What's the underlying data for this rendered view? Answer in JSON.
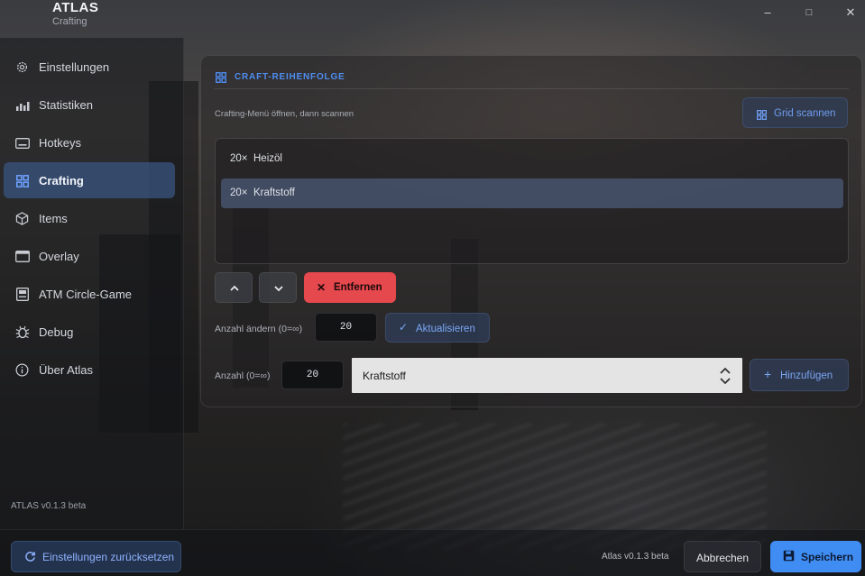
{
  "app": {
    "title": "ATLAS",
    "subtitle": "Crafting"
  },
  "window_controls": {
    "minimize": "–",
    "maximize": "□",
    "close": "✕"
  },
  "sidebar": {
    "items": [
      {
        "label": "Einstellungen",
        "icon": "gear-icon",
        "active": false
      },
      {
        "label": "Statistiken",
        "icon": "bar-chart-icon",
        "active": false
      },
      {
        "label": "Hotkeys",
        "icon": "keyboard-icon",
        "active": false
      },
      {
        "label": "Crafting",
        "icon": "grid-icon",
        "active": true
      },
      {
        "label": "Items",
        "icon": "cube-icon",
        "active": false
      },
      {
        "label": "Overlay",
        "icon": "window-icon",
        "active": false
      },
      {
        "label": "ATM Circle-Game",
        "icon": "atm-icon",
        "active": false
      },
      {
        "label": "Debug",
        "icon": "bug-icon",
        "active": false
      },
      {
        "label": "Über Atlas",
        "icon": "info-icon",
        "active": false
      }
    ],
    "version": "ATLAS v0.1.3 beta"
  },
  "crafting": {
    "section_title": "CRAFT-REIHENFOLGE",
    "hint": "Crafting-Menü öffnen, dann scannen",
    "scan_label": "Grid scannen",
    "queue": [
      {
        "qty": "20×",
        "name": "Heizöl",
        "selected": false
      },
      {
        "qty": "20×",
        "name": "Kraftstoff",
        "selected": true
      }
    ],
    "remove_label": "Entfernen",
    "change_amount_label": "Anzahl ändern (0=∞)",
    "change_amount_value": "20",
    "update_label": "Aktualisieren",
    "amount_label": "Anzahl (0=∞)",
    "amount_value": "20",
    "item_select_value": "Kraftstoff",
    "add_label": "Hinzufügen"
  },
  "footer": {
    "reset_label": "Einstellungen zurücksetzen",
    "version": "Atlas v0.1.3 beta",
    "cancel_label": "Abbrechen",
    "save_label": "Speichern"
  },
  "colors": {
    "accent": "#3f8cf2",
    "danger": "#e5484d",
    "active_nav": "#3a5480"
  }
}
